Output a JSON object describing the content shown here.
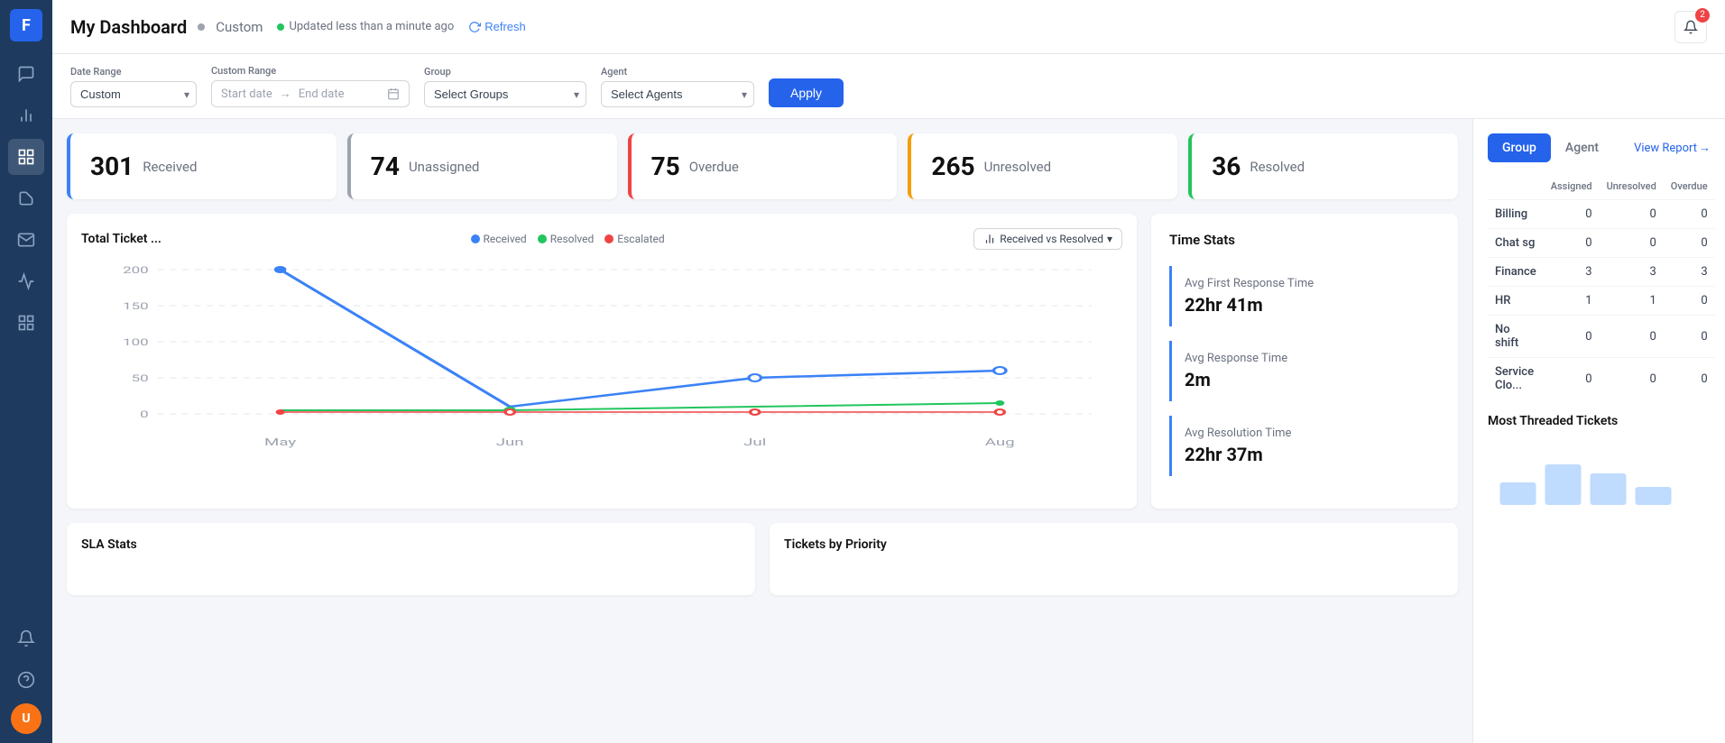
{
  "app": {
    "logo": "F",
    "title": "My Dashboard",
    "separator": "•",
    "custom_label": "Custom",
    "status_text": "Updated less than a minute ago",
    "refresh_label": "Refresh",
    "notification_count": "2"
  },
  "sidebar": {
    "items": [
      {
        "id": "home",
        "icon": "⊞",
        "active": false
      },
      {
        "id": "chat",
        "icon": "💬",
        "active": false
      },
      {
        "id": "bar-chart",
        "icon": "📊",
        "active": false
      },
      {
        "id": "dashboard",
        "icon": "⊞",
        "active": false
      },
      {
        "id": "ticket",
        "icon": "🎫",
        "active": false
      },
      {
        "id": "message",
        "icon": "✉️",
        "active": false
      },
      {
        "id": "analytics",
        "icon": "📈",
        "active": false
      },
      {
        "id": "grid",
        "icon": "⊞",
        "active": false
      },
      {
        "id": "bell",
        "icon": "🔔",
        "active": false
      },
      {
        "id": "help",
        "icon": "?",
        "active": false
      }
    ],
    "avatar_initials": "U"
  },
  "filters": {
    "date_range_label": "Date Range",
    "date_range_value": "Custom",
    "custom_range_label": "Custom Range",
    "start_placeholder": "Start date",
    "arrow": "→",
    "end_placeholder": "End date",
    "group_label": "Group",
    "group_placeholder": "Select Groups",
    "agent_label": "Agent",
    "agent_placeholder": "Select Agents",
    "apply_label": "Apply"
  },
  "stats": [
    {
      "id": "received",
      "number": "301",
      "label": "Received",
      "border": "blue"
    },
    {
      "id": "unassigned",
      "number": "74",
      "label": "Unassigned",
      "border": "gray"
    },
    {
      "id": "overdue",
      "number": "75",
      "label": "Overdue",
      "border": "red"
    },
    {
      "id": "unresolved",
      "number": "265",
      "label": "Unresolved",
      "border": "yellow"
    },
    {
      "id": "resolved",
      "number": "36",
      "label": "Resolved",
      "border": "green"
    }
  ],
  "chart": {
    "title": "Total Ticket ...",
    "legend": [
      {
        "label": "Received",
        "color": "#3b82f6"
      },
      {
        "label": "Resolved",
        "color": "#22c55e"
      },
      {
        "label": "Escalated",
        "color": "#ef4444"
      }
    ],
    "dropdown_label": "Received vs Resolved",
    "x_labels": [
      "May",
      "Jun",
      "Jul",
      "Aug"
    ],
    "y_labels": [
      "200",
      "150",
      "100",
      "50",
      "0"
    ],
    "series": {
      "received": [
        200,
        10,
        50,
        60
      ],
      "resolved": [
        5,
        5,
        10,
        15
      ],
      "escalated": [
        2,
        2,
        2,
        2
      ]
    }
  },
  "time_stats": {
    "title": "Time Stats",
    "items": [
      {
        "label": "Avg First Response Time",
        "value": "22hr 41m"
      },
      {
        "label": "Avg Response Time",
        "value": "2m"
      },
      {
        "label": "Avg Resolution Time",
        "value": "22hr 37m"
      }
    ]
  },
  "bottom_cards": [
    {
      "id": "sla-stats",
      "title": "SLA Stats"
    },
    {
      "id": "tickets-by-priority",
      "title": "Tickets by Priority"
    }
  ],
  "right_panel": {
    "tabs": [
      "Group",
      "Agent"
    ],
    "active_tab": "Group",
    "view_report": "View Report",
    "table_headers": [
      "",
      "Assigned",
      "Unresolved",
      "Overdue"
    ],
    "rows": [
      {
        "name": "Billing",
        "assigned": "0",
        "unresolved": "0",
        "overdue": "0"
      },
      {
        "name": "Chat sg",
        "assigned": "0",
        "unresolved": "0",
        "overdue": "0"
      },
      {
        "name": "Finance",
        "assigned": "3",
        "unresolved": "3",
        "overdue": "3"
      },
      {
        "name": "HR",
        "assigned": "1",
        "unresolved": "1",
        "overdue": "0"
      },
      {
        "name": "No shift",
        "assigned": "0",
        "unresolved": "0",
        "overdue": "0"
      },
      {
        "name": "Service Clo...",
        "assigned": "0",
        "unresolved": "0",
        "overdue": "0"
      }
    ],
    "most_threaded_title": "Most Threaded Tickets"
  }
}
